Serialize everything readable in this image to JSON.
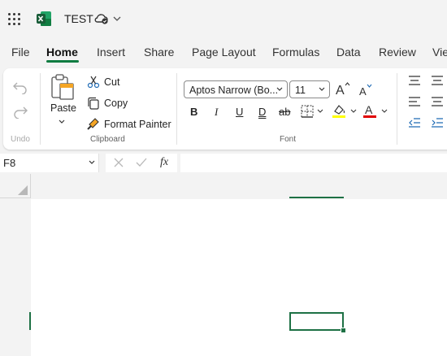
{
  "app": {
    "title": "TEST",
    "brand_color": "#107c41",
    "icon": "excel-icon"
  },
  "tabs": [
    {
      "label": "File"
    },
    {
      "label": "Home"
    },
    {
      "label": "Insert"
    },
    {
      "label": "Share"
    },
    {
      "label": "Page Layout"
    },
    {
      "label": "Formulas"
    },
    {
      "label": "Data"
    },
    {
      "label": "Review"
    },
    {
      "label": "Vie"
    }
  ],
  "ribbon": {
    "undo_group_label": "Undo",
    "clipboard": {
      "paste_label": "Paste",
      "cut_label": "Cut",
      "copy_label": "Copy",
      "format_painter_label": "Format Painter",
      "group_label": "Clipboard"
    },
    "font": {
      "font_name": "Aptos Narrow (Bo...",
      "font_size": "11",
      "bold": "B",
      "italic": "I",
      "underline": "U",
      "double_underline": "D",
      "strikethrough": "ab",
      "group_label": "Font",
      "highlight_color": "#ffff00",
      "font_color": "#e00000"
    }
  },
  "formula_bar": {
    "name_box": "F8",
    "fx_label": "fx",
    "formula": ""
  }
}
